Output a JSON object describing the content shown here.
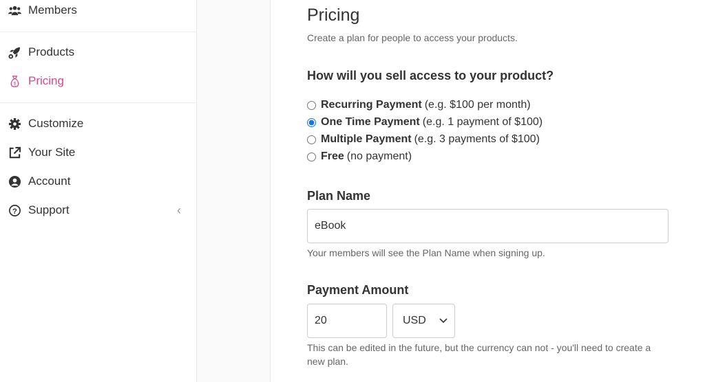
{
  "sidebar": {
    "items": [
      {
        "label": "Members",
        "icon": "users-icon"
      },
      {
        "label": "Products",
        "icon": "rocket-icon"
      },
      {
        "label": "Pricing",
        "icon": "money-bag-icon",
        "active": true
      },
      {
        "label": "Customize",
        "icon": "gear-icon"
      },
      {
        "label": "Your Site",
        "icon": "external-link-icon"
      },
      {
        "label": "Account",
        "icon": "user-circle-icon"
      },
      {
        "label": "Support",
        "icon": "question-circle-icon"
      }
    ],
    "accent": "#d6498b"
  },
  "main": {
    "title": "Pricing",
    "subtitle": "Create a plan for people to access your products.",
    "question": "How will you sell access to your product?",
    "options": [
      {
        "label": "Recurring Payment",
        "hint": "(e.g. $100 per month)",
        "selected": false
      },
      {
        "label": "One Time Payment",
        "hint": "(e.g. 1 payment of $100)",
        "selected": true
      },
      {
        "label": "Multiple Payment",
        "hint": "(e.g. 3 payments of $100)",
        "selected": false
      },
      {
        "label": "Free",
        "hint": "(no payment)",
        "selected": false
      }
    ],
    "plan_name": {
      "label": "Plan Name",
      "value": "eBook",
      "help": "Your members will see the Plan Name when signing up."
    },
    "payment": {
      "label": "Payment Amount",
      "amount": "20",
      "currency": "USD",
      "help": "This can be edited in the future, but the currency can not - you'll need to create a new plan."
    }
  }
}
